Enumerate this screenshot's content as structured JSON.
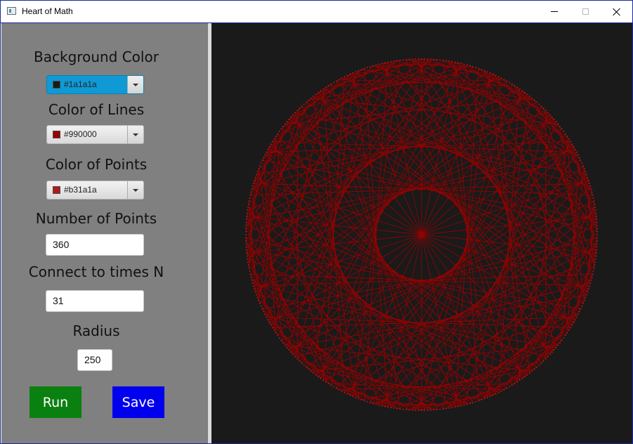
{
  "window": {
    "title": "Heart of Math",
    "icon": "app-window-icon"
  },
  "controls": {
    "background_color": {
      "label": "Background Color",
      "value": "#1a1a1a",
      "display": "#1a1a1a",
      "swatch": "#1a1a1a"
    },
    "line_color": {
      "label": "Color of Lines",
      "value": "#990000",
      "display": "#990000",
      "swatch": "#990000"
    },
    "point_color": {
      "label": "Color of Points",
      "value": "#b31a1a",
      "display": "#b31a1a",
      "swatch": "#b31a1a"
    },
    "num_points": {
      "label": "Number of Points",
      "value": "360"
    },
    "multiplier": {
      "label": "Connect to times N",
      "value": "31"
    },
    "radius": {
      "label": "Radius",
      "value": "250"
    },
    "run_label": "Run",
    "save_label": "Save"
  },
  "colors": {
    "panel": "#808080",
    "canvas_bg": "#1a1a1a",
    "run_button": "#0a8010",
    "save_button": "#0000ee",
    "picker_active": "#0f9ad6"
  }
}
